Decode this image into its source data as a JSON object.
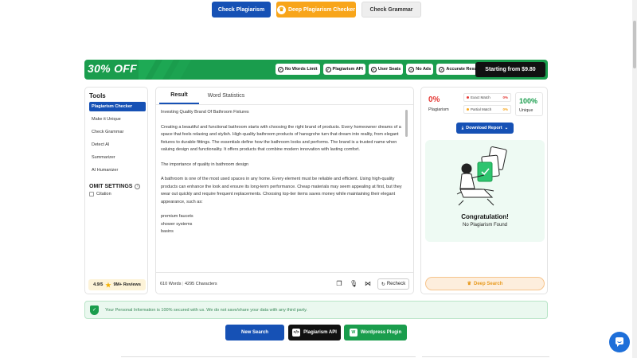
{
  "top_buttons": {
    "check_plagiarism": "Check Plagiarism",
    "deep_checker": "Deep Plagiarism Checker",
    "check_grammar": "Check Grammar"
  },
  "promo": {
    "discount": "30% OFF",
    "features": [
      "No Words Limit",
      "Plagiarism API",
      "User Seats",
      "No Ads",
      "Accurate Result"
    ],
    "price_cta": "Starting from $9.80"
  },
  "tools": {
    "title": "Tools",
    "items": [
      "Plagiarism Checker",
      "Make it Unique",
      "Check Grammar",
      "Detect AI",
      "Summarizer",
      "AI Humanizer"
    ],
    "active_index": 0,
    "omit_title": "OMIT SETTINGS",
    "citation_label": "Citation",
    "rating": "4.9/5",
    "reviews": "9M+ Reviews"
  },
  "editor": {
    "tabs": [
      "Result",
      "Word Statistics"
    ],
    "paragraphs": [
      "Investing Quality Brand Of Bathroom Fixtures",
      "Creating a beautiful and functional bathroom starts with choosing the right brand of products. Every homeowner dreams of a space that feels relaxing and stylish. High-quality bathroom products of hansgrohe turn that dream into reality, from elegant fixtures to durable fittings. The essentials define how the bathroom looks and performs. The brand is a trusted name when valuing design and functionality. It offers products that combine modern innovation with lasting comfort.",
      "The importance of quality in bathroom design",
      "A bathroom is one of the most used spaces in any home. Every element must be reliable and efficient. Using high-quality products can enhance the look and ensure its long-term performance. Cheap materials may seem appealing at first, but they wear out quickly and require frequent replacements. Choosing top-tier items saves money while maintaining their elegant appearance, such as:"
    ],
    "list_items": [
      "premium faucets",
      "shower systems",
      "basins"
    ],
    "word_count": "610 Words",
    "char_count": "4295 Characters",
    "recheck_label": "Recheck"
  },
  "report": {
    "plagiarism_pct": "0%",
    "plagiarism_label": "Plagiarism",
    "exact_match_label": "Exact Match",
    "exact_match_value": "0%",
    "partial_match_label": "Partial Match",
    "partial_match_value": "0%",
    "unique_pct": "100%",
    "unique_label": "Unique",
    "download_label": "Download Report",
    "congrats_title": "Congratulation!",
    "congrats_sub": "No Plagiarism Found",
    "deep_search_label": "Deep Search"
  },
  "privacy": {
    "message": "Your Personal Information is 100% secured with us. We do not save/share your data with any third party."
  },
  "bottom_buttons": {
    "new_search": "New Search",
    "api": "Plagiarism API",
    "wordpress": "Wordpress Plugin"
  },
  "colors": {
    "primary": "#1651b5",
    "success": "#1a9d4d",
    "warning": "#f8a51a",
    "danger": "#e53935"
  }
}
